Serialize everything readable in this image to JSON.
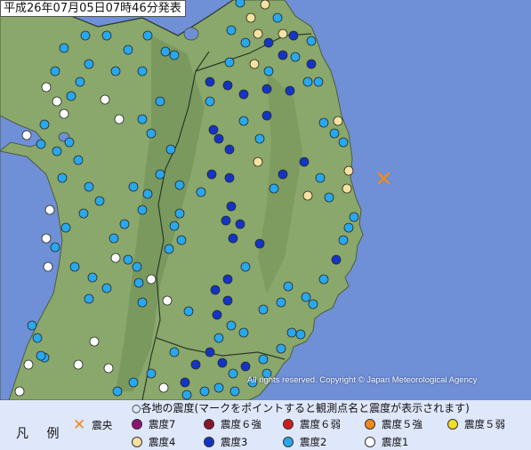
{
  "header": {
    "timestamp": "平成26年07月05日07時46分発表"
  },
  "copyright": "All rights reserved. Copyright © Japan Meteorological Agency",
  "legend": {
    "title": "凡 例",
    "note": "○各地の震度(マークをポイントすると観測点名と震度が表示されます)",
    "epicenter_label": "震央",
    "intensity_items": [
      {
        "label": "震度7",
        "color": "#8e1273"
      },
      {
        "label": "震度６強",
        "color": "#8a1428"
      },
      {
        "label": "震度６弱",
        "color": "#cf1d1d"
      },
      {
        "label": "震度５強",
        "color": "#f0891c"
      },
      {
        "label": "震度５弱",
        "color": "#f2e027"
      },
      {
        "label": "震度4",
        "color": "#f7e2a0"
      },
      {
        "label": "震度3",
        "color": "#1334c4"
      },
      {
        "label": "震度2",
        "color": "#28a8ee"
      },
      {
        "label": "震度1",
        "color": "#ffffff"
      }
    ]
  },
  "colors": {
    "sea": "#6f8fd6",
    "land": "#8aa86b",
    "land_dark": "#6b8a52",
    "border": "#2a3a2a"
  }
}
